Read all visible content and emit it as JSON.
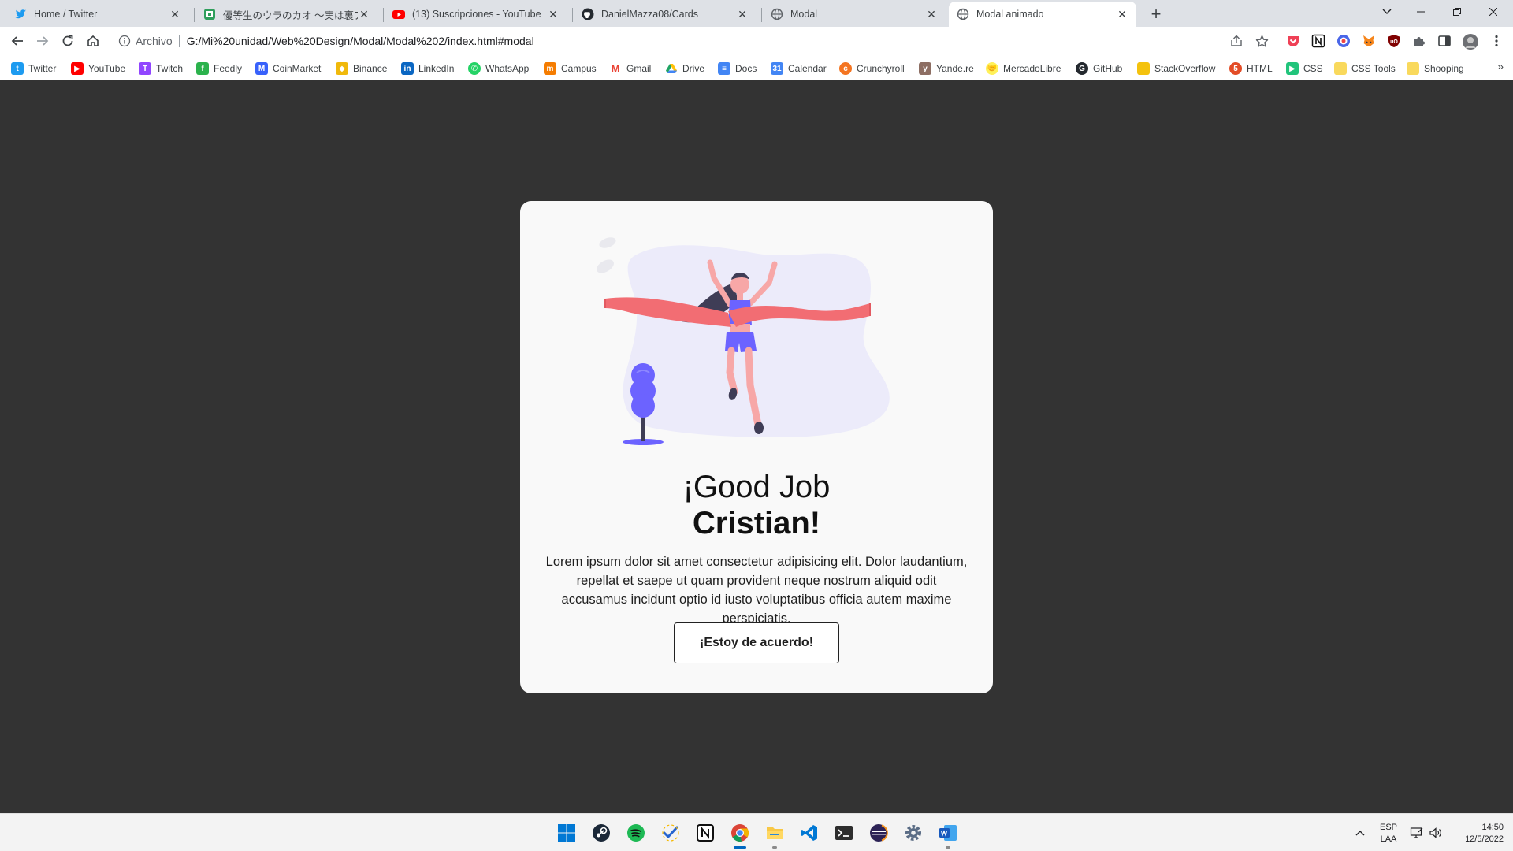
{
  "browser": {
    "tabs": [
      {
        "title": "Home / Twitter",
        "icon": "twitter-icon",
        "active": false
      },
      {
        "title": "優等生のウラのカオ 〜実は裏アカ女子",
        "icon": "manga-site-icon",
        "active": false
      },
      {
        "title": "(13) Suscripciones - YouTube",
        "icon": "youtube-icon",
        "active": false
      },
      {
        "title": "DanielMazza08/Cards",
        "icon": "github-icon",
        "active": false
      },
      {
        "title": "Modal",
        "icon": "globe-icon",
        "active": false
      },
      {
        "title": "Modal animado",
        "icon": "globe-icon",
        "active": true
      }
    ],
    "new_tab": "+",
    "address": {
      "scheme": "Archivo",
      "url": "G:/Mi%20unidad/Web%20Design/Modal/Modal%202/index.html#modal"
    },
    "bookmarks": [
      {
        "label": "Twitter",
        "color": "#1d9bf0"
      },
      {
        "label": "YouTube",
        "color": "#ff0000"
      },
      {
        "label": "Twitch",
        "color": "#9146ff"
      },
      {
        "label": "Feedly",
        "color": "#2bb24c"
      },
      {
        "label": "CoinMarket",
        "color": "#3861fb"
      },
      {
        "label": "Binance",
        "color": "#f0b90b"
      },
      {
        "label": "LinkedIn",
        "color": "#0a66c2"
      },
      {
        "label": "WhatsApp",
        "color": "#25d366"
      },
      {
        "label": "Campus",
        "color": "#f57c00"
      },
      {
        "label": "Gmail",
        "color": "#ea4335"
      },
      {
        "label": "Drive",
        "color": "#1fa463"
      },
      {
        "label": "Docs",
        "color": "#4285f4"
      },
      {
        "label": "Calendar",
        "color": "#4285f4"
      },
      {
        "label": "Crunchyroll",
        "color": "#f47521"
      },
      {
        "label": "Yande.re",
        "color": "#8d6e63"
      },
      {
        "label": "MercadoLibre",
        "color": "#fff159"
      },
      {
        "label": "GitHub",
        "color": "#24292f"
      },
      {
        "label": "StackOverflow",
        "color": "#f4c20d"
      },
      {
        "label": "HTML",
        "color": "#e34c26"
      },
      {
        "label": "CSS",
        "color": "#21c47b"
      },
      {
        "label": "CSS Tools",
        "color": "#f9d95c"
      },
      {
        "label": "Shooping",
        "color": "#f9d95c"
      }
    ],
    "more_bookmarks": "»"
  },
  "modal": {
    "title_line1": "¡Good Job",
    "title_line2": "Cristian!",
    "text": "Lorem ipsum dolor sit amet consectetur adipisicing elit. Dolor laudantium, repellat et saepe ut quam provident neque nostrum aliquid odit accusamus incidunt optio id iusto voluptatibus officia autem maxime perspiciatis.",
    "button_label": "¡Estoy de acuerdo!",
    "colors": {
      "accent": "#6c63ff",
      "ribbon": "#f26d73",
      "blob": "#ecebfa",
      "hair": "#3f3d56",
      "skin": "#f7a7a7"
    }
  },
  "taskbar": {
    "apps": [
      "windows-start-icon",
      "steam-icon",
      "spotify-icon",
      "todo-icon",
      "notion-icon",
      "chrome-icon",
      "file-explorer-icon",
      "vscode-icon",
      "terminal-icon",
      "eclipse-icon",
      "settings-icon",
      "word-icon"
    ],
    "language": "ESP",
    "layout": "LAA",
    "time": "14:50",
    "date": "12/5/2022"
  }
}
